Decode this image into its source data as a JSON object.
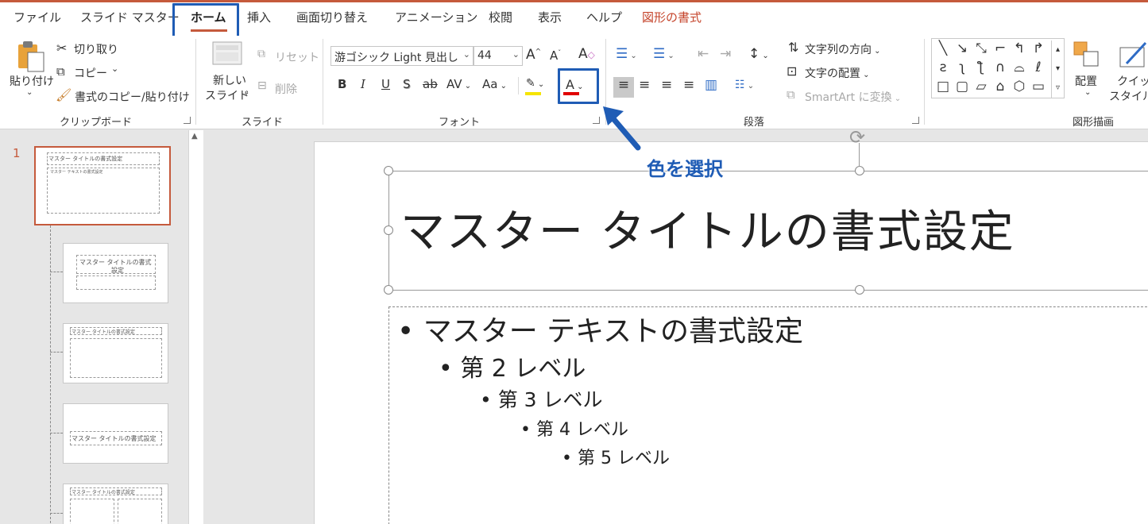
{
  "tabs": [
    "ファイル",
    "スライド マスター",
    "ホーム",
    "挿入",
    "画面切り替え",
    "アニメーション",
    "校閲",
    "表示",
    "ヘルプ",
    "図形の書式"
  ],
  "active_tab": "ホーム",
  "clipboard": {
    "paste": "貼り付け",
    "cut": "切り取り",
    "copy": "コピー",
    "format_painter": "書式のコピー/貼り付け",
    "group": "クリップボード"
  },
  "slides_group": {
    "new_slide_1": "新しい",
    "new_slide_2": "スライド",
    "reset": "リセット",
    "delete": "削除",
    "group": "スライド"
  },
  "font": {
    "name": "游ゴシック Light 見出し",
    "size": "44",
    "bold": "B",
    "italic": "I",
    "underline": "U",
    "shadow": "S",
    "strike": "ab",
    "spacing": "AV",
    "case": "Aa",
    "grow": "A",
    "shrink": "A",
    "color_letter": "A",
    "group": "フォント",
    "font_color_accent": "#e00000",
    "highlight_accent": "#f5e400"
  },
  "paragraph": {
    "text_direction": "文字列の方向",
    "align_text": "文字の配置",
    "smartart": "SmartArt に変換",
    "group": "段落"
  },
  "drawing": {
    "arrange": "配置",
    "quick_styles_1": "クイック",
    "quick_styles_2": "スタイル",
    "group": "図形描画"
  },
  "annotation": "色を選択",
  "slide_number": "1",
  "thumbnails": {
    "master_title": "マスター タイトルの書式設定",
    "master_text": "マスター テキストの書式設定",
    "level2": "第 2 レベル",
    "layout_title_short": "マスター タイトルの書式",
    "layout_sub": "設定"
  },
  "slide": {
    "title": "マスター タイトルの書式設定",
    "bullets": [
      "マスター テキストの書式設定",
      "第 2 レベル",
      "第 3 レベル",
      "第 4 レベル",
      "第 5 レベル"
    ]
  }
}
